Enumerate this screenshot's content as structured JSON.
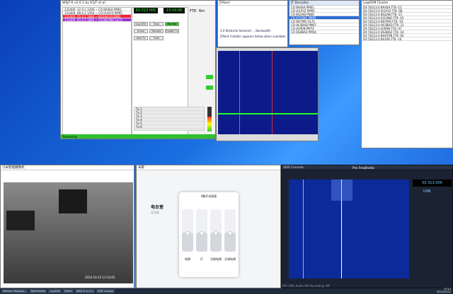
{
  "wsjt": {
    "title": "WSJT-X v2.6.1 by K1JT et al.",
    "freq": "50.313 000",
    "time": "13:14:08",
    "mode": "FT8",
    "band": "6m",
    "buttons": [
      "Log QSO",
      "Stop",
      "Monitor",
      "Erase",
      "Decode",
      "Enable Tx",
      "Halt Tx",
      "Tune"
    ],
    "tx_rows": [
      "Tx 1",
      "Tx 2",
      "Tx 3",
      "Tx 4",
      "Tx 5",
      "Tx 6"
    ],
    "status": "Receiving"
  },
  "jtalert": {
    "title": "JTAlert",
    "message": "3.0 Kilohertz Selected ... Bandwidth",
    "notice": "JTAlert Installer appears below when available"
  },
  "calllist": {
    "title": "JT Decodes",
    "rows": [
      "CQ BA4SA PM01",
      "CQ JA1XYZ PM95",
      "CQ BG2AB PN46",
      "CQ JO1QNO PM95",
      "CQ BD7MQ OL72",
      "CQ HL5BHD PM47",
      "CQ JA3RJN PM74",
      "CQ DS4BAZ PM54"
    ]
  },
  "logger": {
    "title": "Log4OM Cluster",
    "rows": [
      "DX 50313.0 BA4SA FT8 -12",
      "DX 50313.0 JA1XYZ FT8 -08",
      "DX 50313.0 BG2AB FT8 -15",
      "DX 50313.0 JO1QNO FT8 -03",
      "DX 50313.0 BD7MQ FT8 -19",
      "DX 50313.0 HL5BHD FT8 -11",
      "DX 50313.0 JA3RJN FT8 -07",
      "DX 50313.0 DS4BAZ FT8 -14",
      "DX 50313.0 BH4TXN FT8 -02",
      "DX 50313.0 BA1PK FT8 -10"
    ]
  },
  "camera": {
    "title": "小米智能摄像机",
    "timestamp": "2024-10-22 13:14:05"
  },
  "smarthome": {
    "title": "米家",
    "room": "电台室",
    "subtitle": "未分配",
    "dialog_title": "4路开关面板",
    "switch_labels": [
      "电源",
      "灯",
      "功放电源",
      "天调电源"
    ],
    "switch_levels": [
      0.45,
      0.45,
      0.45,
      0.45
    ]
  },
  "sdr": {
    "title": "SDR Console",
    "panel_title": "Pro FreqRadio",
    "freq": "50.313.000",
    "mode_label": "USB",
    "status_bar": "CPU 18%   Audio OK   Recording: Off"
  },
  "taskbar": {
    "items": [
      "Network Diagnos...",
      "TeamViewer",
      "Log4OM",
      "JTAlert",
      "WSJT-X v2.6.1",
      "SDR Console"
    ],
    "clock_time": "13:14",
    "clock_date": "2024/10/22"
  }
}
